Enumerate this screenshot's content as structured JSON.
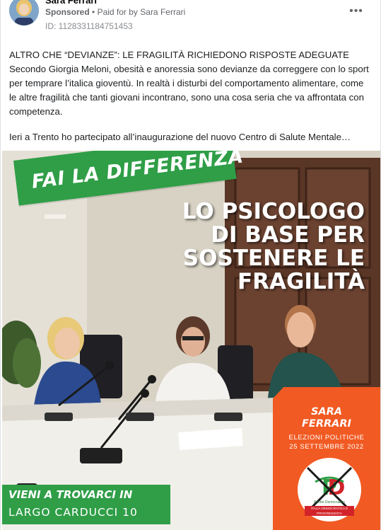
{
  "post": {
    "author": "Sara Ferrari",
    "sponsored_label": "Sponsored",
    "separator": "•",
    "paid_for": "Paid for by Sara Ferrari",
    "ad_id": "ID: 1128331184751453",
    "more_icon": "more-horizontal-icon"
  },
  "body": {
    "paragraph1_line1": "ALTRO CHE “DEVIANZE”: LE FRAGILITÀ RICHIEDONO RISPOSTE ADEGUATE",
    "paragraph1_rest": "Secondo Giorgia Meloni, obesità e anoressia sono devianze da correggere con lo sport per temprare l’italica gioventù. In realtà i disturbi del comportamento alimentare, come le altre fragilità che tanti giovani incontrano, sono una cosa seria che va affrontata con competenza.",
    "paragraph2": "Ieri a Trento ho partecipato all’inaugurazione del nuovo Centro di Salute Mentale…"
  },
  "ad_image": {
    "banner_top": "FAI LA DIFFERENZA",
    "headline": [
      "LO PSICOLOGO",
      "DI BASE PER",
      "SOSTENERE LE",
      "FRAGILITÀ"
    ],
    "banner_bottom_line1": "VIENI A TROVARCI IN",
    "banner_bottom_line2": "LARGO CARDUCCI 10",
    "candidate_first": "SARA",
    "candidate_last": "FERRARI",
    "election_line1": "ELEZIONI POLITICHE",
    "election_line2": "25 SETTEMBRE 2022",
    "logo_subtitle": "Partito Democratico",
    "logo_ribbon": "ITALIA DEMOCRATICA E PROGRESSISTA",
    "colors": {
      "green": "#2f9e47",
      "orange": "#f15a22",
      "red": "#d2232a"
    }
  }
}
